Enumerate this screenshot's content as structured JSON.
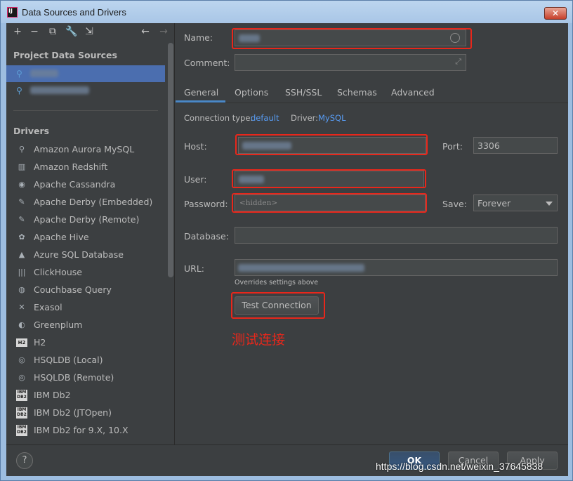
{
  "window": {
    "title": "Data Sources and Drivers",
    "close_glyph": "✕"
  },
  "toolbar": {
    "icons": [
      "plus-icon",
      "minus-icon",
      "copy-icon",
      "wrench-icon",
      "import-icon",
      "back-arrow-icon",
      "forward-arrow-icon"
    ]
  },
  "left": {
    "project_title": "Project Data Sources",
    "drivers_title": "Drivers",
    "drivers": [
      {
        "label": "Amazon Aurora MySQL",
        "icon": "aurora-icon"
      },
      {
        "label": "Amazon Redshift",
        "icon": "redshift-icon"
      },
      {
        "label": "Apache Cassandra",
        "icon": "cassandra-icon"
      },
      {
        "label": "Apache Derby (Embedded)",
        "icon": "derby-icon"
      },
      {
        "label": "Apache Derby (Remote)",
        "icon": "derby-icon"
      },
      {
        "label": "Apache Hive",
        "icon": "hive-icon"
      },
      {
        "label": "Azure SQL Database",
        "icon": "azure-icon"
      },
      {
        "label": "ClickHouse",
        "icon": "clickhouse-icon"
      },
      {
        "label": "Couchbase Query",
        "icon": "couchbase-icon"
      },
      {
        "label": "Exasol",
        "icon": "exasol-icon"
      },
      {
        "label": "Greenplum",
        "icon": "greenplum-icon"
      },
      {
        "label": "H2",
        "icon": "h2-icon"
      },
      {
        "label": "HSQLDB (Local)",
        "icon": "hsqldb-icon"
      },
      {
        "label": "HSQLDB (Remote)",
        "icon": "hsqldb-icon"
      },
      {
        "label": "IBM Db2",
        "icon": "db2-icon"
      },
      {
        "label": "IBM Db2 (JTOpen)",
        "icon": "db2-icon"
      },
      {
        "label": "IBM Db2 for 9.X, 10.X",
        "icon": "db2-icon"
      }
    ]
  },
  "form": {
    "name_label": "Name:",
    "comment_label": "Comment:",
    "tabs": [
      "General",
      "Options",
      "SSH/SSL",
      "Schemas",
      "Advanced"
    ],
    "active_tab": "General",
    "connection_type_label": "Connection type:",
    "connection_type_value": "default",
    "driver_label": "Driver:",
    "driver_value": "MySQL",
    "host_label": "Host:",
    "port_label": "Port:",
    "port_value": "3306",
    "user_label": "User:",
    "password_label": "Password:",
    "password_value": "<hidden>",
    "save_label": "Save:",
    "save_value": "Forever",
    "database_label": "Database:",
    "url_label": "URL:",
    "overrides_note": "Overrides settings above",
    "test_connection": "Test Connection",
    "annotation": "测试连接"
  },
  "footer": {
    "help": "?",
    "ok": "OK",
    "cancel": "Cancel",
    "apply": "Apply",
    "watermark": "https://blog.csdn.net/weixin_37645838"
  },
  "colors": {
    "background": "#3c3f41",
    "selection": "#4b6eaf",
    "link": "#589df6",
    "highlight": "#e8271b"
  }
}
